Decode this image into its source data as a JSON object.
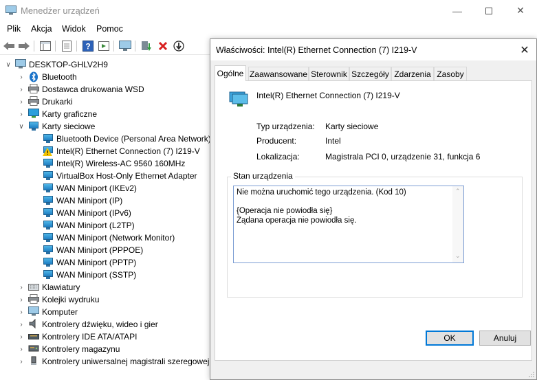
{
  "window": {
    "title": "Menedżer urządzeń"
  },
  "menu": [
    "Plik",
    "Akcja",
    "Widok",
    "Pomoc"
  ],
  "tree": {
    "root": "DESKTOP-GHLV2H9",
    "categories": [
      "Bluetooth",
      "Dostawca drukowania WSD",
      "Drukarki",
      "Karty graficzne",
      "Karty sieciowe"
    ],
    "network_adapters": [
      "Bluetooth Device (Personal Area Network)",
      "Intel(R) Ethernet Connection (7) I219-V",
      "Intel(R) Wireless-AC 9560 160MHz",
      "VirtualBox Host-Only Ethernet Adapter",
      "WAN Miniport (IKEv2)",
      "WAN Miniport (IP)",
      "WAN Miniport (IPv6)",
      "WAN Miniport (L2TP)",
      "WAN Miniport (Network Monitor)",
      "WAN Miniport (PPPOE)",
      "WAN Miniport (PPTP)",
      "WAN Miniport (SSTP)"
    ],
    "more_categories": [
      "Klawiatury",
      "Kolejki wydruku",
      "Komputer",
      "Kontrolery dźwięku, wideo i gier",
      "Kontrolery IDE ATA/ATAPI",
      "Kontrolery magazynu",
      "Kontrolery uniwersalnej magistrali szeregowej"
    ]
  },
  "dialog": {
    "title": "Właściwości: Intel(R) Ethernet Connection (7) I219-V",
    "tabs": [
      "Ogólne",
      "Zaawansowane",
      "Sterownik",
      "Szczegóły",
      "Zdarzenia",
      "Zasoby"
    ],
    "device_name": "Intel(R) Ethernet Connection (7) I219-V",
    "props": {
      "type_label": "Typ urządzenia:",
      "type_value": "Karty sieciowe",
      "mfr_label": "Producent:",
      "mfr_value": "Intel",
      "loc_label": "Lokalizacja:",
      "loc_value": "Magistrala PCI 0, urządzenie 31, funkcja 6"
    },
    "status_group_label": "Stan urządzenia",
    "status_text": "Nie można uruchomić tego urządzenia. (Kod 10)\n\n{Operacja nie powiodła się}\nŻądana operacja nie powiodła się.",
    "ok_label": "OK",
    "cancel_label": "Anuluj"
  }
}
